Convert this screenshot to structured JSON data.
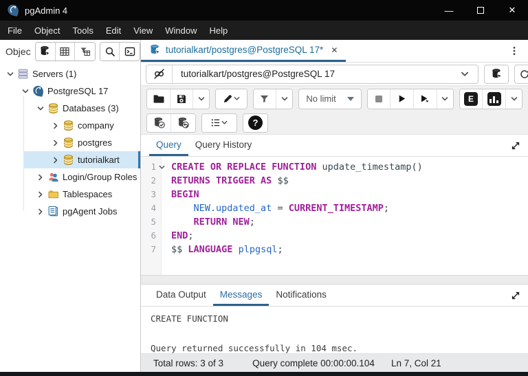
{
  "window": {
    "title": "pgAdmin 4",
    "controls": {
      "minimize": "—",
      "close": "✕"
    }
  },
  "menu": {
    "items": [
      "File",
      "Object",
      "Tools",
      "Edit",
      "View",
      "Window",
      "Help"
    ]
  },
  "object_explorer": {
    "header_label": "Object Explorer",
    "tree": [
      {
        "label": "Servers (1)"
      },
      {
        "label": "PostgreSQL 17"
      },
      {
        "label": "Databases (3)"
      },
      {
        "label": "company"
      },
      {
        "label": "postgres"
      },
      {
        "label": "tutorialkart"
      },
      {
        "label": "Login/Group Roles"
      },
      {
        "label": "Tablespaces"
      },
      {
        "label": "pgAgent Jobs"
      }
    ]
  },
  "doc_tab": {
    "title": "tutorialkart/postgres@PostgreSQL 17*",
    "close_glyph": "✕"
  },
  "connection": {
    "value": "tutorialkart/postgres@PostgreSQL 17"
  },
  "toolbar": {
    "limit_label": "No limit",
    "explain_label": "E",
    "help_label": "?"
  },
  "editor_tabs": {
    "query": "Query",
    "history": "Query History"
  },
  "editor": {
    "lines": [
      {
        "num": "1",
        "fold": true,
        "segments": [
          [
            "k",
            "CREATE OR REPLACE FUNCTION"
          ],
          [
            "t",
            " update_timestamp()"
          ]
        ]
      },
      {
        "num": "2",
        "segments": [
          [
            "k",
            "RETURNS TRIGGER AS"
          ],
          [
            "t",
            " $$"
          ]
        ]
      },
      {
        "num": "3",
        "segments": [
          [
            "k",
            "BEGIN"
          ]
        ]
      },
      {
        "num": "4",
        "segments": [
          [
            "t",
            "    "
          ],
          [
            "v",
            "NEW.updated_at"
          ],
          [
            "t",
            " = "
          ],
          [
            "k",
            "CURRENT_TIMESTAMP"
          ],
          [
            "t",
            ";"
          ]
        ]
      },
      {
        "num": "5",
        "segments": [
          [
            "t",
            "    "
          ],
          [
            "k",
            "RETURN NEW"
          ],
          [
            "t",
            ";"
          ]
        ]
      },
      {
        "num": "6",
        "segments": [
          [
            "k",
            "END"
          ],
          [
            "t",
            ";"
          ]
        ]
      },
      {
        "num": "7",
        "segments": [
          [
            "t",
            "$$ "
          ],
          [
            "k",
            "LANGUAGE"
          ],
          [
            "t",
            " "
          ],
          [
            "v",
            "plpgsql"
          ],
          [
            "t",
            ";"
          ]
        ]
      }
    ]
  },
  "output_tabs": {
    "data_output": "Data Output",
    "messages": "Messages",
    "notifications": "Notifications"
  },
  "messages": {
    "result": "CREATE FUNCTION",
    "summary": "Query returned successfully in 104 msec."
  },
  "status_bar": {
    "total_rows": "Total rows: 3 of 3",
    "query_complete": "Query complete 00:00:00.104",
    "cursor_position": "Ln 7, Col 21"
  },
  "icons": {
    "titlebar": "pgadmin-elephant-logo",
    "sidebar_toolbar": [
      "query-tool-icon",
      "view-data-icon",
      "filtered-rows-icon",
      "search-icon",
      "psql-tool-icon"
    ],
    "colors": {
      "accent": "#326690",
      "keyword": "#a0209a",
      "variable": "#2265cc",
      "selection": "#d2e8f6",
      "database_yellow": "#e3bc45"
    }
  }
}
